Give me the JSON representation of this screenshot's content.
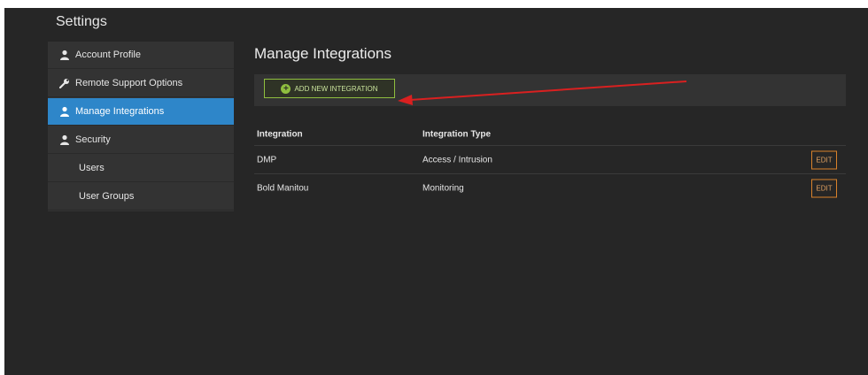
{
  "app": {
    "title": "Settings"
  },
  "sidebar": {
    "items": [
      {
        "label": "Account Profile",
        "icon": "user-icon"
      },
      {
        "label": "Remote Support Options",
        "icon": "wrench-icon"
      },
      {
        "label": "Manage Integrations",
        "icon": "user-icon",
        "active": true
      },
      {
        "label": "Security",
        "icon": "user-icon"
      },
      {
        "label": "Users"
      },
      {
        "label": "User Groups"
      }
    ]
  },
  "main": {
    "title": "Manage Integrations",
    "add_button_label": "ADD NEW INTEGRATION",
    "add_icon": "plus-circle-icon",
    "table": {
      "headers": [
        "Integration",
        "Integration Type"
      ],
      "rows": [
        {
          "integration": "DMP",
          "type": "Access / Intrusion",
          "action": "EDIT"
        },
        {
          "integration": "Bold Manitou",
          "type": "Monitoring",
          "action": "EDIT"
        }
      ]
    }
  },
  "colors": {
    "background": "#262626",
    "panel": "#333333",
    "active": "#2e86c9",
    "add_button_border": "#8fbf3f",
    "edit_button_border": "#d9822b",
    "annotation_arrow": "#d92020"
  }
}
